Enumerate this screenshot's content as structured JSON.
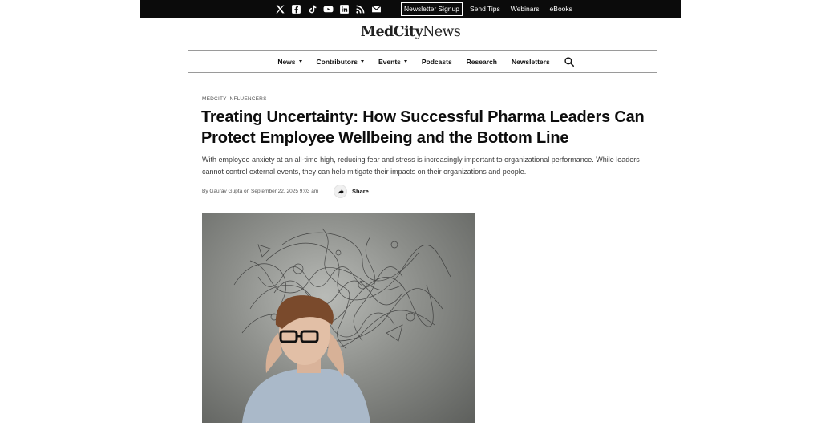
{
  "topbar": {
    "social_icons": [
      "x-icon",
      "facebook-icon",
      "tiktok-icon",
      "youtube-icon",
      "linkedin-icon",
      "rss-icon",
      "email-icon"
    ],
    "links": [
      {
        "label": "Newsletter Signup",
        "boxed": true
      },
      {
        "label": "Send Tips",
        "boxed": false
      },
      {
        "label": "Webinars",
        "boxed": false
      },
      {
        "label": "eBooks",
        "boxed": false
      }
    ]
  },
  "logo": {
    "part1": "MedCity",
    "part2": "News"
  },
  "nav": {
    "items": [
      {
        "label": "News",
        "dropdown": true
      },
      {
        "label": "Contributors",
        "dropdown": true
      },
      {
        "label": "Events",
        "dropdown": true
      },
      {
        "label": "Podcasts",
        "dropdown": false
      },
      {
        "label": "Research",
        "dropdown": false
      },
      {
        "label": "Newsletters",
        "dropdown": false
      }
    ],
    "search_icon": "search-icon"
  },
  "article": {
    "kicker": "MEDCITY INFLUENCERS",
    "title": "Treating Uncertainty: How Successful Pharma Leaders Can Protect Employee Wellbeing and the Bottom Line",
    "dek": "With employee anxiety at an all-time high, reducing fear and stress is increasingly important to organizational performance. While leaders cannot control external events, they can help mitigate their impacts on their organizations and people.",
    "byline": "By Gaurav Gupta on September 22, 2025 9:03 am",
    "share_label": "Share",
    "share_icon": "share-arrow-icon"
  },
  "colors": {
    "topbar": "#0b0b0b",
    "text": "#111111",
    "rule": "#9a9a9a"
  }
}
